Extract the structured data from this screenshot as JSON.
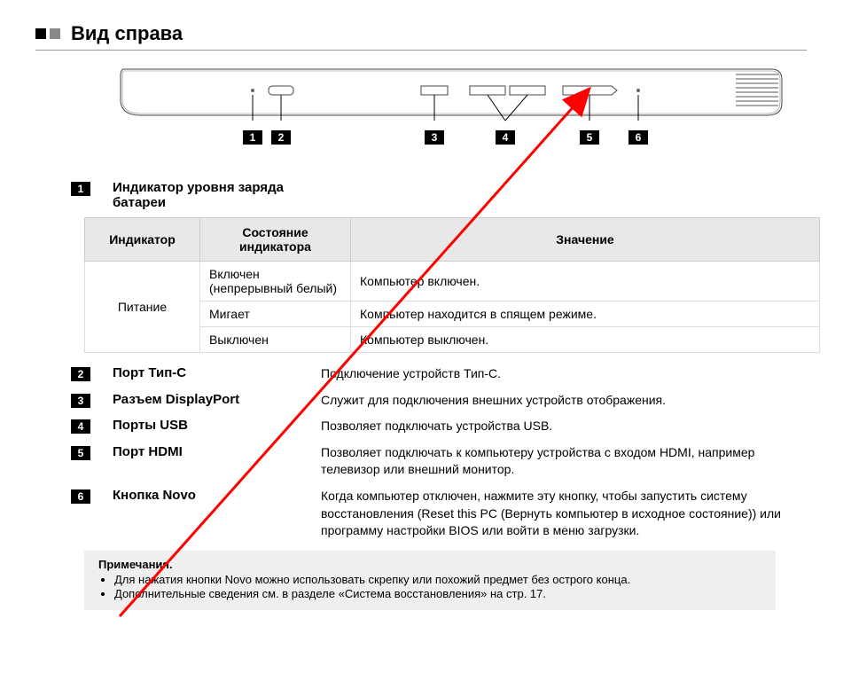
{
  "heading": "Вид справа",
  "callouts": [
    "1",
    "2",
    "3",
    "4",
    "5",
    "6"
  ],
  "item1": {
    "num": "1",
    "label": "Индикатор уровня заряда батареи"
  },
  "table": {
    "h1": "Индикатор",
    "h2": "Состояние индикатора",
    "h3": "Значение",
    "col1": "Питание",
    "r1c2": "Включен (непрерывный белый)",
    "r1c3": "Компьютер включен.",
    "r2c2": "Мигает",
    "r2c3": "Компьютер находится в спящем режиме.",
    "r3c2": "Выключен",
    "r3c3": "Компьютер выключен."
  },
  "item2": {
    "num": "2",
    "label": "Порт Тип-С",
    "desc": "Подключение устройств Тип-С."
  },
  "item3": {
    "num": "3",
    "label": "Разъем DisplayPort",
    "desc": "Служит для подключения внешних устройств отображения."
  },
  "item4": {
    "num": "4",
    "label": "Порты USB",
    "desc": "Позволяет подключать устройства USB."
  },
  "item5": {
    "num": "5",
    "label": "Порт HDMI",
    "desc": "Позволяет подключать к компьютеру устройства с входом HDMI, например телевизор или внешний монитор."
  },
  "item6": {
    "num": "6",
    "label": "Кнопка Novo",
    "desc": "Когда компьютер отключен, нажмите эту кнопку, чтобы запустить систему восстановления (Reset this PC (Вернуть компьютер в исходное состояние)) или программу настройки BIOS или войти в меню загрузки."
  },
  "notes": {
    "title": "Примечания.",
    "n1": "Для нажатия кнопки Novo можно использовать скрепку или похожий предмет без острого конца.",
    "n2": "Дополнительные сведения см. в разделе «Система восстановления» на стр. 17."
  }
}
